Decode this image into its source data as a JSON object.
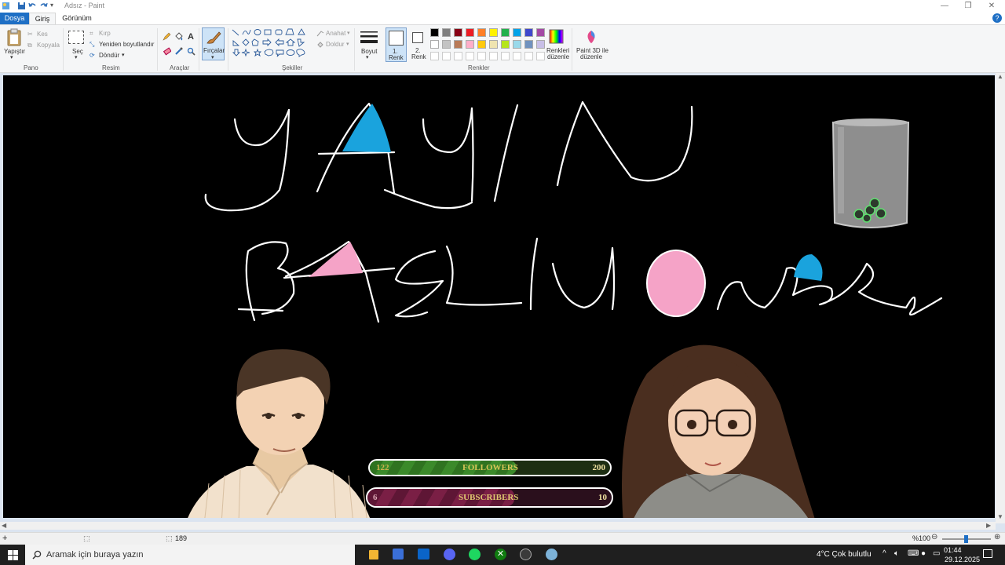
{
  "window": {
    "title": "Adsız - Paint"
  },
  "tabs": {
    "file": "Dosya",
    "home": "Giriş",
    "view": "Görünüm"
  },
  "ribbon": {
    "clipboard": {
      "paste": "Yapıştır",
      "cut": "Kes",
      "copy": "Kopyala",
      "label": "Pano"
    },
    "image": {
      "select": "Seç",
      "crop": "Kırp",
      "resize": "Yeniden boyutlandır",
      "rotate": "Döndür",
      "label": "Resim"
    },
    "tools": {
      "label": "Araçlar"
    },
    "brushes": {
      "label": "Fırçalar"
    },
    "shapes": {
      "outline": "Anahat",
      "fill": "Doldur",
      "label": "Şekiller"
    },
    "size": {
      "label": "Boyut"
    },
    "colors": {
      "color1_a": "1.",
      "color1_b": "Renk",
      "color2_a": "2.",
      "color2_b": "Renk",
      "edit_colors_a": "Renkleri",
      "edit_colors_b": "düzenle",
      "paint3d_a": "Paint 3D ile",
      "paint3d_b": "düzenle",
      "label": "Renkler",
      "palette_row1": [
        "#000000",
        "#7f7f7f",
        "#880015",
        "#ed1c24",
        "#ff7f27",
        "#fff200",
        "#22b14c",
        "#00a2e8",
        "#3f48cc",
        "#a349a4"
      ],
      "palette_row2": [
        "#ffffff",
        "#c3c3c3",
        "#b97a57",
        "#ffaec9",
        "#ffc90e",
        "#efe4b0",
        "#b5e61d",
        "#99d9ea",
        "#7092be",
        "#c8bfe7"
      ]
    }
  },
  "overlay": {
    "followers": {
      "current": "122",
      "label": "FOLLOWERS",
      "goal": "200",
      "progress": 0.61
    },
    "subscribers": {
      "current": "6",
      "label": "SUBSCRIBERS",
      "goal": "10",
      "progress": 0.6
    }
  },
  "statusbar": {
    "dims": "189",
    "zoom": "%100"
  },
  "taskbar": {
    "search_placeholder": "Aramak için buraya yazın",
    "weather": "4°C  Çok bulutlu",
    "time": "01:44",
    "date": "29.12.2025"
  }
}
